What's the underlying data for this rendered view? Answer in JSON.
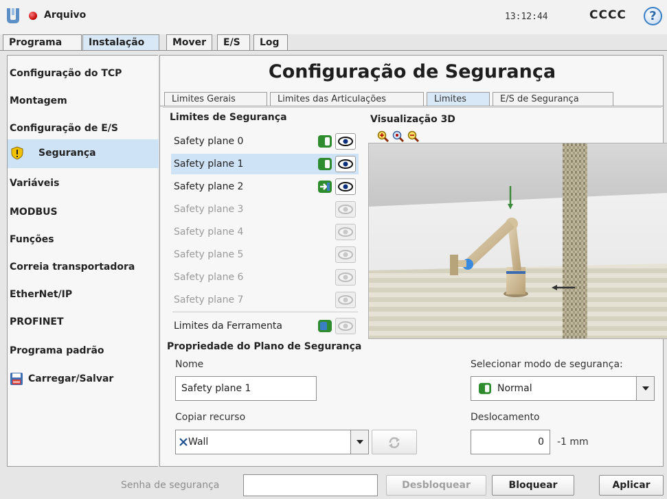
{
  "header": {
    "file_name": "Arquivo",
    "clock": "13:12:44",
    "robot_name": "CCCC",
    "help_label": "?"
  },
  "top_tabs": [
    {
      "label": "Programa",
      "active": false
    },
    {
      "label": "Instalação",
      "active": true
    },
    {
      "label": "Mover",
      "active": false
    },
    {
      "label": "E/S",
      "active": false
    },
    {
      "label": "Log",
      "active": false
    }
  ],
  "sidebar": {
    "items": [
      {
        "label": "Configuração do TCP"
      },
      {
        "label": "Montagem"
      },
      {
        "label": "Configuração de E/S"
      },
      {
        "label": "Segurança",
        "active": true,
        "icon": "warning-shield-icon"
      },
      {
        "label": "Variáveis"
      },
      {
        "label": "MODBUS"
      },
      {
        "label": "Funções"
      },
      {
        "label": "Correia transportadora"
      },
      {
        "label": "EtherNet/IP"
      },
      {
        "label": "PROFINET"
      },
      {
        "label": "Programa padrão"
      },
      {
        "label": "Carregar/Salvar",
        "icon": "floppy-disk-icon"
      }
    ]
  },
  "main": {
    "title": "Configuração de Segurança",
    "sub_tabs": [
      {
        "label": "Limites Gerais"
      },
      {
        "label": "Limites das Articulações"
      },
      {
        "label": "Limites",
        "active": true
      },
      {
        "label": "E/S de Segurança"
      }
    ],
    "limits_title": "Limites de Segurança",
    "planes": [
      {
        "label": "Safety plane 0",
        "mode": "normal",
        "enabled": true
      },
      {
        "label": "Safety plane 1",
        "mode": "normal",
        "enabled": true,
        "selected": true
      },
      {
        "label": "Safety plane 2",
        "mode": "trigger",
        "enabled": true
      },
      {
        "label": "Safety plane 3",
        "enabled": false
      },
      {
        "label": "Safety plane 4",
        "enabled": false
      },
      {
        "label": "Safety plane 5",
        "enabled": false
      },
      {
        "label": "Safety plane 6",
        "enabled": false
      },
      {
        "label": "Safety plane 7",
        "enabled": false
      }
    ],
    "tool_limits_label": "Limites da Ferramenta",
    "viz_title": "Visualização 3D",
    "zoom_icons": [
      "zoom-in-icon",
      "zoom-reset-icon",
      "zoom-out-icon"
    ],
    "plane_props_title": "Propriedade do Plano de Segurança",
    "name_label": "Nome",
    "name_value": "Safety plane 1",
    "copy_feature_label": "Copiar recurso",
    "copy_feature_value": "Wall",
    "safety_mode_label": "Selecionar modo de segurança:",
    "safety_mode_value": "Normal",
    "offset_label": "Deslocamento",
    "offset_value": "0",
    "offset_unit": "-1 mm"
  },
  "footer": {
    "password_label": "Senha de segurança",
    "password_value": "",
    "unlock_label": "Desbloquear",
    "lock_label": "Bloquear",
    "apply_label": "Aplicar"
  },
  "colors": {
    "accent_blue": "#cfe3f6",
    "mode_green": "#2e8b2e",
    "status_red": "#c00000"
  }
}
